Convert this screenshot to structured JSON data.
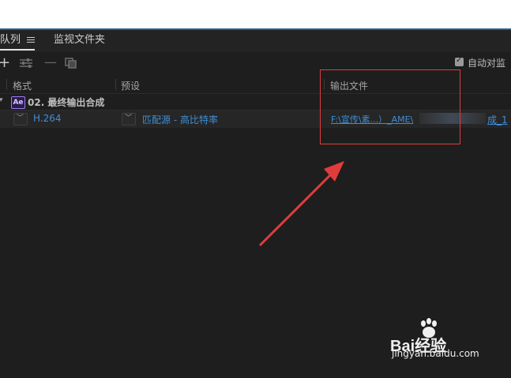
{
  "tabs": {
    "queue_label": "队列",
    "watch_label": "监视文件夹"
  },
  "toolbar": {
    "add_icon": "plus-icon",
    "settings_icon": "sliders-icon",
    "remove_icon": "minus-icon",
    "duplicate_icon": "duplicate-icon",
    "auto_label": "自动对监",
    "auto_checked": true
  },
  "columns": {
    "format": "格式",
    "preset": "预设",
    "output": "输出文件"
  },
  "group": {
    "badge": "Ae",
    "name": "02. 最终输出合成"
  },
  "item": {
    "format": "H.264",
    "preset": "匹配源 - 高比特率",
    "output_part1": "F:\\宣传\\素...）_AME\\",
    "output_part2": "成_1"
  },
  "watermark": {
    "logo": "Bai经验",
    "url": "jingyan.baidu.com"
  },
  "colors": {
    "accent_blue": "#3f8fd8",
    "annotation_red": "#e13c3c",
    "ae_purple": "#9a7cf2",
    "panel_bg": "#1e1e1e"
  }
}
